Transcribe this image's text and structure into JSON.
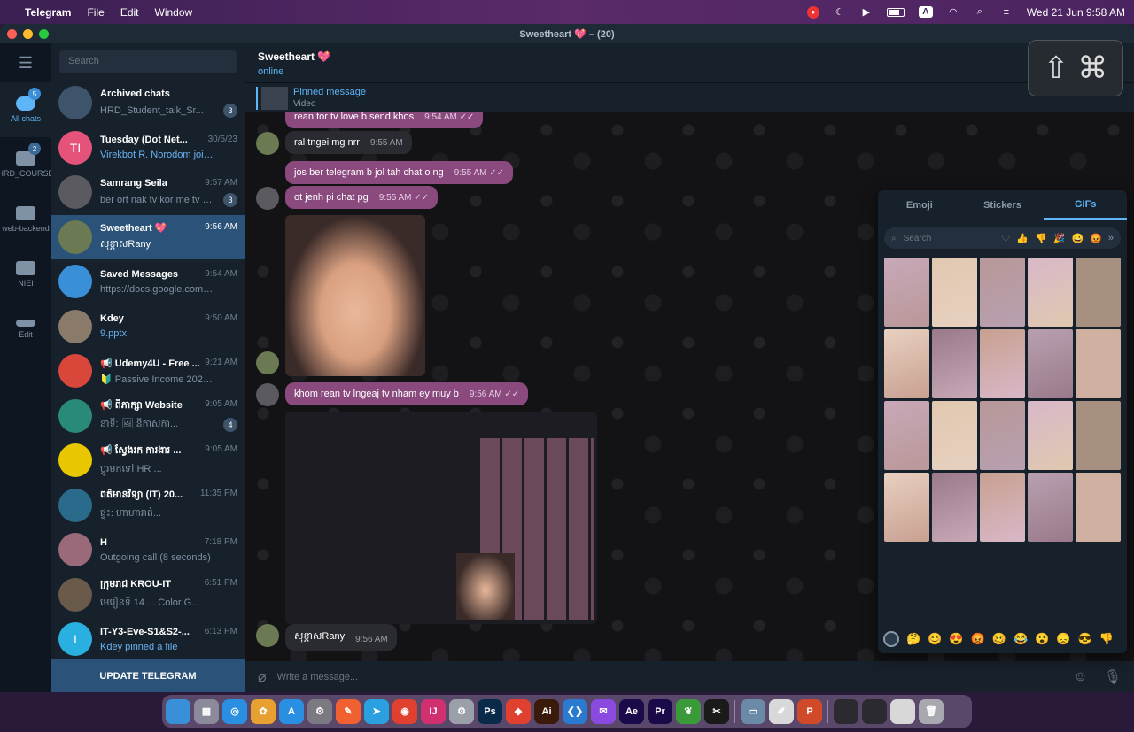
{
  "menubar": {
    "app_name": "Telegram",
    "menus": [
      "File",
      "Edit",
      "Window"
    ],
    "clock": "Wed 21 Jun  9:58 AM",
    "input_source": "A"
  },
  "window": {
    "title": "Sweetheart 💖 – (20)"
  },
  "folders": [
    {
      "label": "All chats",
      "badge": "5",
      "active": true
    },
    {
      "label": "HRD_COURSE",
      "badge": "2",
      "active": false
    },
    {
      "label": "web-backend",
      "badge": "",
      "active": false
    },
    {
      "label": "NIEI",
      "badge": "",
      "active": false
    },
    {
      "label": "Edit",
      "badge": "",
      "active": false
    }
  ],
  "search": {
    "placeholder": "Search"
  },
  "chats": [
    {
      "name": "Archived chats",
      "time": "",
      "message": "HRD_Student_talk_Sr...",
      "badge": "3",
      "avatar_text": "",
      "avatar_color": "#3e546a",
      "active": false,
      "message_blue": false
    },
    {
      "name": "Tuesday (Dot Net...",
      "time": "30/5/23",
      "message": "Virekbot R. Norodom join...",
      "badge": "",
      "avatar_text": "TI",
      "avatar_color": "#e5527a",
      "active": false,
      "message_blue": true
    },
    {
      "name": "Samrang Seila",
      "time": "9:57 AM",
      "message": "ber ort nak tv kor me tv derl",
      "badge": "3",
      "avatar_text": "",
      "avatar_color": "#5a5a60",
      "active": false,
      "message_blue": false
    },
    {
      "name": "Sweetheart 💖",
      "time": "9:56 AM",
      "message": "សុខ្ភាសRany",
      "badge": "",
      "avatar_text": "",
      "avatar_color": "#6b7a52",
      "active": true,
      "message_blue": false
    },
    {
      "name": "Saved Messages",
      "time": "9:54 AM",
      "message": "https://docs.google.com/pres...",
      "badge": "",
      "avatar_text": "",
      "avatar_color": "#3a8fd9",
      "active": false,
      "message_blue": false
    },
    {
      "name": "Kdey",
      "time": "9:50 AM",
      "message": "9.pptx",
      "badge": "",
      "avatar_text": "",
      "avatar_color": "#8a7a6a",
      "active": false,
      "message_blue": true
    },
    {
      "name": "📢 Udemy4U - Free ...",
      "time": "9:21 AM",
      "message": "🔰 Passive Income 2023 - ...",
      "badge": "",
      "avatar_text": "",
      "avatar_color": "#d9473a",
      "active": false,
      "message_blue": false
    },
    {
      "name": "📢 ពិភាក្សា Website",
      "time": "9:05 AM",
      "message": "នាទី: 🖼 និកាសកា...",
      "badge": "4",
      "avatar_text": "",
      "avatar_color": "#2a8a7a",
      "active": false,
      "message_blue": false
    },
    {
      "name": "📢 ស្វែងរក ការងារ ...",
      "time": "9:05 AM",
      "message": "ប្តូរមកទៅ HR ...",
      "badge": "",
      "avatar_text": "",
      "avatar_color": "#e8c700",
      "active": false,
      "message_blue": false
    },
    {
      "name": "ពត៌មានវិទ្យា (IT) 20...",
      "time": "11:35 PM",
      "message": "ផ្ទុះ: ហាហារាត់...",
      "badge": "",
      "avatar_text": "",
      "avatar_color": "#2a6a8a",
      "active": false,
      "message_blue": false
    },
    {
      "name": "H",
      "time": "7:18 PM",
      "message": "Outgoing call (8 seconds)",
      "badge": "",
      "avatar_text": "",
      "avatar_color": "#9a6a7a",
      "active": false,
      "message_blue": false
    },
    {
      "name": "ក្រុមរាជ KROU-IT",
      "time": "6:51 PM",
      "message": "មេរៀនទី 14 ... Color G...",
      "badge": "",
      "avatar_text": "",
      "avatar_color": "#6a5a4a",
      "active": false,
      "message_blue": false
    },
    {
      "name": "IT-Y3-Eve-S1&S2-...",
      "time": "6:13 PM",
      "message": "Kdey pinned a file",
      "badge": "",
      "avatar_text": "I",
      "avatar_color": "#2ab0e0",
      "active": false,
      "message_blue": true
    }
  ],
  "update_button": "UPDATE TELEGRAM",
  "chat": {
    "name": "Sweetheart 💖",
    "status": "online",
    "pinned_title": "Pinned message",
    "pinned_sub": "Video",
    "messages": [
      {
        "text": "rean tor tv love b send khos",
        "time": "9:54 AM",
        "check": "✓✓",
        "out": true
      },
      {
        "text": "ral tngei mg nrr",
        "time": "9:55 AM",
        "check": "",
        "out": false
      },
      {
        "text": "jos ber telegram b jol tah chat o ng",
        "time": "9:55 AM",
        "check": "✓✓",
        "out": true
      },
      {
        "text": "ot jenh pi chat pg",
        "time": "9:55 AM",
        "check": "✓✓",
        "out": true
      },
      {
        "text": "khom rean tv lngeaj tv nham ey muy b",
        "time": "9:56 AM",
        "check": "✓✓",
        "out": true
      },
      {
        "text": "សុខ្ភាសRany",
        "time": "9:56 AM",
        "check": "",
        "out": false
      }
    ],
    "composer_placeholder": "Write a message..."
  },
  "gif_panel": {
    "tabs": [
      "Emoji",
      "Stickers",
      "GIFs"
    ],
    "active_tab": "GIFs",
    "search_placeholder": "Search",
    "category_icons": [
      "♡",
      "👍",
      "👎",
      "🎉",
      "😀",
      "😡",
      "»"
    ],
    "bottom_emojis": [
      "🤔",
      "😊",
      "😍",
      "😡",
      "🥴",
      "😂",
      "😮",
      "😞",
      "😎",
      "👎"
    ]
  },
  "dock": {
    "apps": [
      {
        "name": "finder-icon",
        "label": "",
        "color": "#3a8fd9"
      },
      {
        "name": "launchpad-icon",
        "label": "▦",
        "color": "#8a8a9a"
      },
      {
        "name": "safari-icon",
        "label": "◎",
        "color": "#2a8fe0"
      },
      {
        "name": "photos-icon",
        "label": "✿",
        "color": "#e8a030"
      },
      {
        "name": "appstore-icon",
        "label": "A",
        "color": "#2a8fe0"
      },
      {
        "name": "settings-icon",
        "label": "⚙",
        "color": "#7a7a80"
      },
      {
        "name": "swift-icon",
        "label": "✎",
        "color": "#f06030"
      },
      {
        "name": "telegram-icon",
        "label": "➤",
        "color": "#2aa0e0"
      },
      {
        "name": "chrome-icon",
        "label": "◉",
        "color": "#e04030"
      },
      {
        "name": "intellij-icon",
        "label": "IJ",
        "color": "#d03070"
      },
      {
        "name": "utility-icon",
        "label": "⚙",
        "color": "#9aa0a8"
      },
      {
        "name": "photoshop-icon",
        "label": "Ps",
        "color": "#0a2a4a"
      },
      {
        "name": "git-icon",
        "label": "◆",
        "color": "#e04030"
      },
      {
        "name": "illustrator-icon",
        "label": "Ai",
        "color": "#3a1a0a"
      },
      {
        "name": "vscode-icon",
        "label": "❮❯",
        "color": "#2a7ad0"
      },
      {
        "name": "messenger-icon",
        "label": "✉",
        "color": "#8a4ae0"
      },
      {
        "name": "aftereffects-icon",
        "label": "Ae",
        "color": "#1a0a4a"
      },
      {
        "name": "premiere-icon",
        "label": "Pr",
        "color": "#1a0a4a"
      },
      {
        "name": "leaf-icon",
        "label": "❦",
        "color": "#3a9a3a"
      },
      {
        "name": "capcut-icon",
        "label": "✂",
        "color": "#1a1a1a"
      },
      {
        "name": "preview-icon",
        "label": "▭",
        "color": "#6a8aa8"
      },
      {
        "name": "textedit-icon",
        "label": "✐",
        "color": "#d8d8d8"
      },
      {
        "name": "powerpoint-icon",
        "label": "P",
        "color": "#d04a2a"
      },
      {
        "name": "window-thumb-1-icon",
        "label": "",
        "color": "#2a2a30"
      },
      {
        "name": "window-thumb-2-icon",
        "label": "",
        "color": "#2a2a30"
      },
      {
        "name": "window-thumb-3-icon",
        "label": "",
        "color": "#d8d8d8"
      },
      {
        "name": "trash-icon",
        "label": "🗑",
        "color": "#a8a8b0"
      }
    ]
  }
}
